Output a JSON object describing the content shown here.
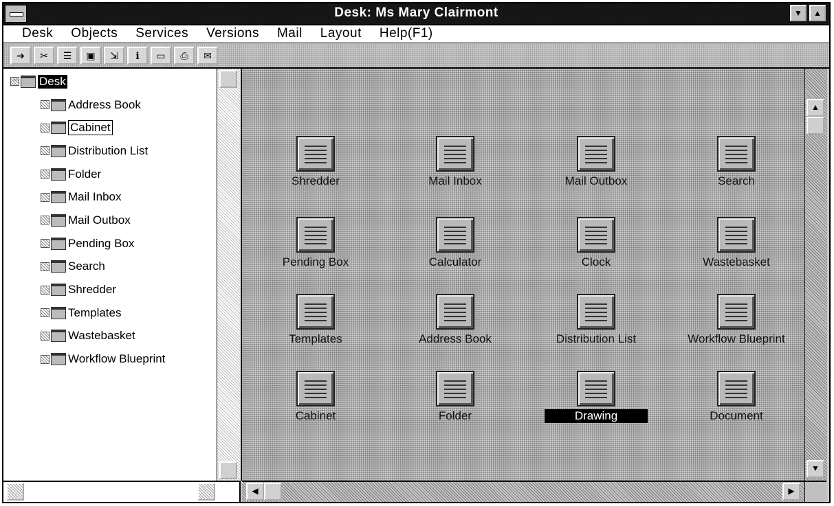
{
  "window": {
    "title": "Desk: Ms Mary Clairmont"
  },
  "menubar": {
    "items": [
      {
        "label": "Desk"
      },
      {
        "label": "Objects"
      },
      {
        "label": "Services"
      },
      {
        "label": "Versions"
      },
      {
        "label": "Mail"
      },
      {
        "label": "Layout"
      },
      {
        "label": "Help(F1)"
      }
    ]
  },
  "toolbar": {
    "tools": [
      {
        "icon": "exit-icon"
      },
      {
        "icon": "tools-icon"
      },
      {
        "icon": "list-icon"
      },
      {
        "icon": "open-icon"
      },
      {
        "icon": "move-icon"
      },
      {
        "icon": "info-icon"
      },
      {
        "icon": "window-icon"
      },
      {
        "icon": "print-icon"
      },
      {
        "icon": "mail-icon"
      }
    ]
  },
  "tree": {
    "root": "Desk",
    "items": [
      {
        "label": "Address Book"
      },
      {
        "label": "Cabinet"
      },
      {
        "label": "Distribution List"
      },
      {
        "label": "Folder"
      },
      {
        "label": "Mail Inbox"
      },
      {
        "label": "Mail Outbox"
      },
      {
        "label": "Pending Box"
      },
      {
        "label": "Search"
      },
      {
        "label": "Shredder"
      },
      {
        "label": "Templates"
      },
      {
        "label": "Wastebasket"
      },
      {
        "label": "Workflow Blueprint"
      }
    ]
  },
  "desk": {
    "icons": [
      {
        "label": "Shredder",
        "icon": "shredder-icon"
      },
      {
        "label": "Mail Inbox",
        "icon": "mail-inbox-icon"
      },
      {
        "label": "Mail Outbox",
        "icon": "mail-outbox-icon"
      },
      {
        "label": "Search",
        "icon": "search-icon"
      },
      {
        "label": "Pending Box",
        "icon": "pending-box-icon"
      },
      {
        "label": "Calculator",
        "icon": "calculator-icon"
      },
      {
        "label": "Clock",
        "icon": "clock-icon"
      },
      {
        "label": "Wastebasket",
        "icon": "wastebasket-icon"
      },
      {
        "label": "Templates",
        "icon": "templates-icon"
      },
      {
        "label": "Address Book",
        "icon": "address-book-icon"
      },
      {
        "label": "Distribution List",
        "icon": "distribution-list-icon"
      },
      {
        "label": "Workflow Blueprint",
        "icon": "workflow-blueprint-icon"
      },
      {
        "label": "Cabinet",
        "icon": "cabinet-icon"
      },
      {
        "label": "Folder",
        "icon": "folder-icon"
      },
      {
        "label": "Drawing",
        "icon": "drawing-icon"
      },
      {
        "label": "Document",
        "icon": "document-icon"
      }
    ]
  }
}
